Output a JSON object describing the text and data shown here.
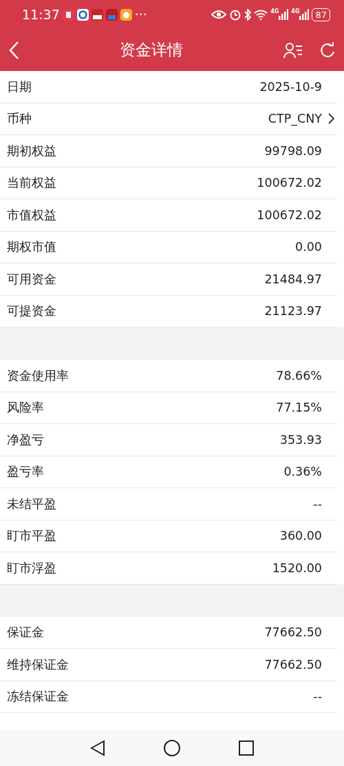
{
  "status_bar": {
    "time": "11:37",
    "more": "···",
    "networks": [
      "4G",
      "4G"
    ],
    "battery": "87"
  },
  "header": {
    "title": "资金详情"
  },
  "sections": [
    {
      "rows": [
        {
          "label": "日期",
          "value": "2025-10-9",
          "has_arrow": false
        },
        {
          "label": "币种",
          "value": "CTP_CNY",
          "has_arrow": true
        },
        {
          "label": "期初权益",
          "value": "99798.09",
          "has_arrow": false
        },
        {
          "label": "当前权益",
          "value": "100672.02",
          "has_arrow": false
        },
        {
          "label": "市值权益",
          "value": "100672.02",
          "has_arrow": false
        },
        {
          "label": "期权市值",
          "value": "0.00",
          "has_arrow": false
        },
        {
          "label": "可用资金",
          "value": "21484.97",
          "has_arrow": false
        },
        {
          "label": "可提资金",
          "value": "21123.97",
          "has_arrow": false
        }
      ]
    },
    {
      "rows": [
        {
          "label": "资金使用率",
          "value": "78.66%",
          "has_arrow": false
        },
        {
          "label": "风险率",
          "value": "77.15%",
          "has_arrow": false
        },
        {
          "label": "净盈亏",
          "value": "353.93",
          "has_arrow": false
        },
        {
          "label": "盈亏率",
          "value": "0.36%",
          "has_arrow": false
        },
        {
          "label": "未结平盈",
          "value": "--",
          "has_arrow": false
        },
        {
          "label": "盯市平盈",
          "value": "360.00",
          "has_arrow": false
        },
        {
          "label": "盯市浮盈",
          "value": "1520.00",
          "has_arrow": false
        }
      ]
    },
    {
      "rows": [
        {
          "label": "保证金",
          "value": "77662.50",
          "has_arrow": false
        },
        {
          "label": "维持保证金",
          "value": "77662.50",
          "has_arrow": false
        },
        {
          "label": "冻结保证金",
          "value": "--",
          "has_arrow": false
        }
      ]
    }
  ]
}
